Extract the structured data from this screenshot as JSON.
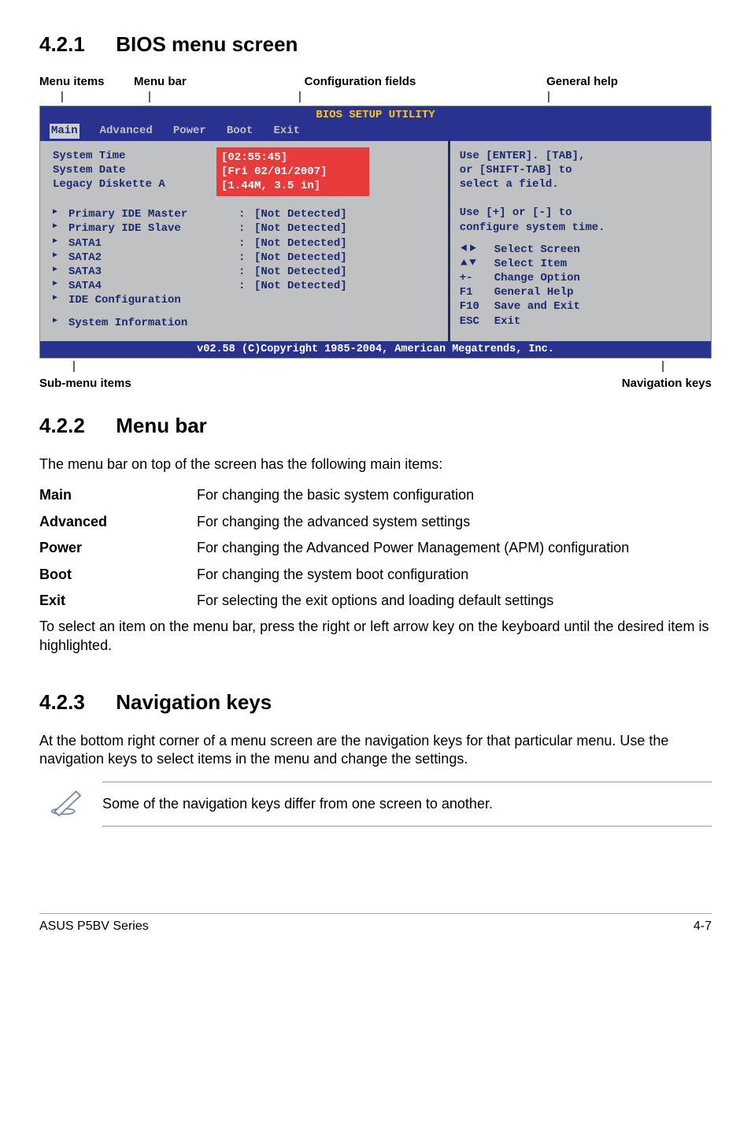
{
  "section_421": {
    "num": "4.2.1",
    "title": "BIOS menu screen"
  },
  "diagram_labels": {
    "menu_items": "Menu items",
    "menu_bar": "Menu bar",
    "config_fields": "Configuration fields",
    "general_help": "General help",
    "sub_menu_items": "Sub-menu items",
    "nav_keys": "Navigation keys"
  },
  "bios": {
    "title": "BIOS SETUP UTILITY",
    "menubar": [
      "Main",
      "Advanced",
      "Power",
      "Boot",
      "Exit"
    ],
    "left_top": [
      {
        "label": "System Time",
        "val": "[02:55:45]",
        "hl": true
      },
      {
        "label": "System Date",
        "val": "[Fri 02/01/2007]",
        "hl": true
      },
      {
        "label": "Legacy Diskette A",
        "val": "[1.44M, 3.5 in]",
        "hl": true
      }
    ],
    "left_list": [
      {
        "label": "Primary IDE Master",
        "val": "[Not Detected]"
      },
      {
        "label": "Primary IDE Slave",
        "val": "[Not Detected]"
      },
      {
        "label": "SATA1",
        "val": "[Not Detected]"
      },
      {
        "label": "SATA2",
        "val": "[Not Detected]"
      },
      {
        "label": "SATA3",
        "val": "[Not Detected]"
      },
      {
        "label": "SATA4",
        "val": "[Not Detected]"
      },
      {
        "label": "IDE Configuration",
        "val": ""
      }
    ],
    "left_last": "System Information",
    "help_top": [
      "Use [ENTER]. [TAB],",
      "or [SHIFT-TAB] to",
      "select a field.",
      "",
      "Use [+] or [-] to",
      "configure system time."
    ],
    "help_nav": [
      {
        "k": "⯇⯈",
        "t": "Select Screen"
      },
      {
        "k": "⯅⯆",
        "t": "Select Item"
      },
      {
        "k": "+-",
        "t": "Change Option"
      },
      {
        "k": "F1",
        "t": "General Help"
      },
      {
        "k": "F10",
        "t": "Save and Exit"
      },
      {
        "k": "ESC",
        "t": "Exit"
      }
    ],
    "footer": "v02.58 (C)Copyright 1985-2004, American Megatrends, Inc."
  },
  "section_422": {
    "num": "4.2.2",
    "title": "Menu bar"
  },
  "menubar_intro": "The menu bar on top of the screen has the following main items:",
  "menubar_defs": [
    {
      "term": "Main",
      "def": "For changing the basic system configuration"
    },
    {
      "term": "Advanced",
      "def": "For changing the advanced system settings"
    },
    {
      "term": "Power",
      "def": "For changing the Advanced Power Management (APM) configuration"
    },
    {
      "term": "Boot",
      "def": "For changing the system boot configuration"
    },
    {
      "term": "Exit",
      "def": "For selecting the exit options and loading default settings"
    }
  ],
  "menubar_outro": "To select an item on the menu bar, press the right or left arrow key on the keyboard until the desired item is highlighted.",
  "section_423": {
    "num": "4.2.3",
    "title": "Navigation keys"
  },
  "navkeys_text": "At the bottom right corner of a menu screen are the navigation keys for that particular menu. Use the navigation keys to select items in the menu and change the settings.",
  "note_text": "Some of the navigation keys differ from one screen to another.",
  "footer_left": "ASUS P5BV Series",
  "footer_right": "4-7"
}
